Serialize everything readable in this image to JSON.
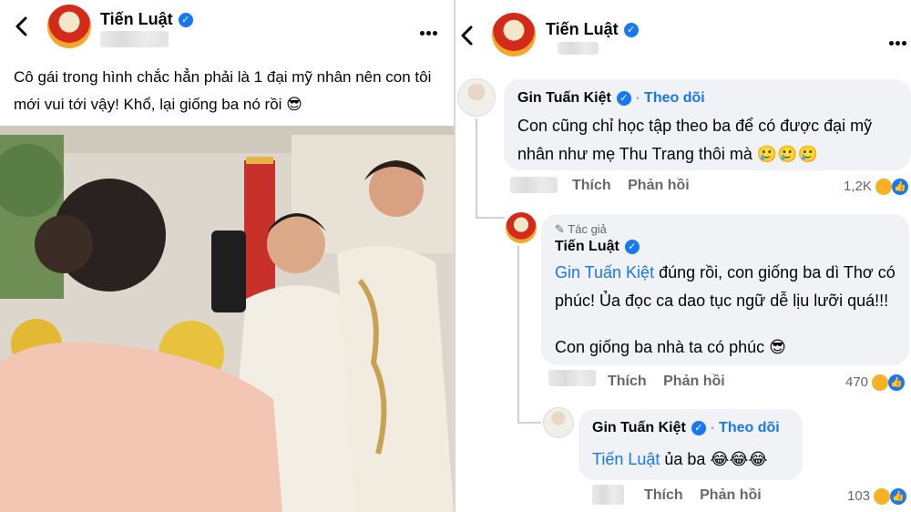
{
  "left_post": {
    "author": "Tiến Luật",
    "text": "Cô gái trong hình chắc hẳn phải là 1 đại mỹ nhân nên con tôi mới vui tới vậy! Khổ, lại giống ba nó rồi 😎"
  },
  "right_post": {
    "author": "Tiến Luật"
  },
  "comments": [
    {
      "author": "Gin Tuấn Kiệt",
      "follow": "Theo dõi",
      "text": "Con cũng chỉ học tập theo ba để có được đại mỹ nhân như mẹ Thu Trang thôi mà 🥲🥲🥲",
      "like": "Thích",
      "reply": "Phản hồi",
      "count": "1,2K"
    },
    {
      "badge": "Tác giả",
      "author": "Tiến Luật",
      "mention": "Gin Tuấn Kiệt",
      "text1": " đúng rồi, con giống ba dì Thơ có phúc! Ủa đọc ca dao tục ngữ dễ lịu lưỡi quá!!!",
      "text2": "Con giống ba nhà ta có phúc 😎",
      "like": "Thích",
      "reply": "Phản hồi",
      "count": "470"
    },
    {
      "author": "Gin Tuấn Kiệt",
      "follow": "Theo dõi",
      "mention": "Tiến Luật",
      "text": " ủa ba 😂😂😂",
      "like": "Thích",
      "reply": "Phản hồi",
      "count": "103"
    }
  ],
  "icons": {
    "back": "chevron-left-icon",
    "more": "more-horizontal-icon",
    "verified": "verified-badge-icon",
    "haha": "haha-reaction-icon",
    "like": "like-reaction-icon"
  },
  "colors": {
    "link": "#1877f2",
    "bubble": "#f0f2f5",
    "muted": "#65676b"
  }
}
